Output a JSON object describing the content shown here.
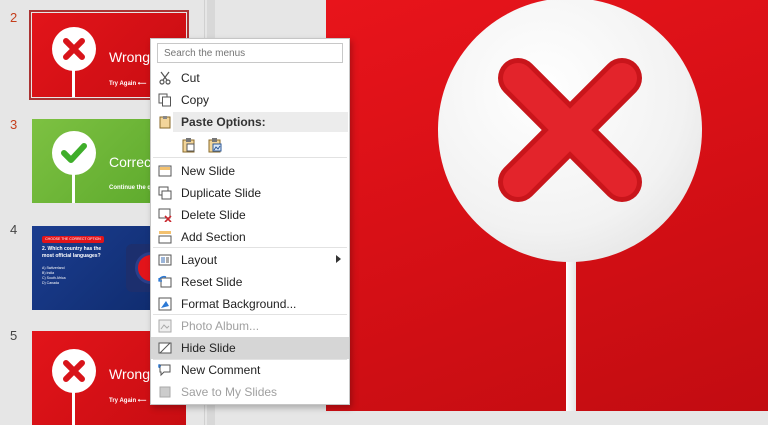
{
  "thumbnails": [
    {
      "number": "2",
      "title": "Wrong",
      "subtitle": "Try Again ⟵",
      "theme": "red",
      "active": true
    },
    {
      "number": "3",
      "title": "Correct",
      "subtitle": "Continue the q",
      "theme": "green",
      "active": true
    },
    {
      "number": "4",
      "quiz_header": "CHOOSE THE CORRECT OPTION",
      "quiz_question": "2. Which country has the most official languages?",
      "quiz_options": [
        "A) Switzerland",
        "B) India",
        "C) South Africa",
        "D) Canada"
      ],
      "theme": "blue",
      "active": false
    },
    {
      "number": "5",
      "title": "Wrong",
      "subtitle": "Try Again ⟵",
      "theme": "red",
      "active": false
    }
  ],
  "context_menu": {
    "search_placeholder": "Search the menus",
    "cut": "Cut",
    "copy": "Copy",
    "paste_options": "Paste Options:",
    "new_slide": "New Slide",
    "duplicate_slide": "Duplicate Slide",
    "delete_slide": "Delete Slide",
    "add_section": "Add Section",
    "layout": "Layout",
    "reset_slide": "Reset Slide",
    "format_background": "Format Background...",
    "photo_album": "Photo Album...",
    "hide_slide": "Hide Slide",
    "new_comment": "New Comment",
    "save_to_my_slides": "Save to My Slides"
  },
  "colors": {
    "accent_red": "#e2141a",
    "slide_number_active": "#c43e1c",
    "correct_green": "#6ab536",
    "quiz_blue": "#1b3d8f"
  }
}
